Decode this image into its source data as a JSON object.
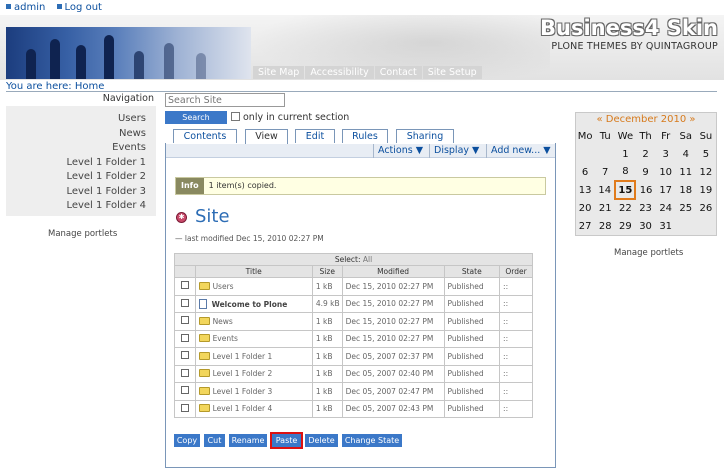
{
  "personal_bar": {
    "items": [
      "admin",
      "Log out"
    ]
  },
  "brand": {
    "name": "Business4 Skin",
    "tagline": "PLONE THEMES BY QUINTAGROUP"
  },
  "site_actions": [
    "Site Map",
    "Accessibility",
    "Contact",
    "Site Setup"
  ],
  "breadcrumb": "You are here: Home",
  "navigation": {
    "title": "Navigation",
    "items": [
      "Users",
      "News",
      "Events",
      "Level 1 Folder 1",
      "Level 1 Folder 2",
      "Level 1 Folder 3",
      "Level 1 Folder 4"
    ],
    "manage": "Manage portlets"
  },
  "search": {
    "placeholder": "Search Site",
    "button": "Search",
    "only_current": "only in current section"
  },
  "tabs": [
    "Contents",
    "View",
    "Edit",
    "Rules",
    "Sharing"
  ],
  "active_tab": "View",
  "menus": [
    "Actions ▼",
    "Display ▼",
    "Add new... ▼"
  ],
  "info": {
    "tag": "Info",
    "message": "1 item(s) copied."
  },
  "page": {
    "title": "Site",
    "modified": "— last modified Dec 15, 2010 02:27 PM"
  },
  "table": {
    "select_label": "Select:",
    "select_all": "All",
    "headers": [
      "",
      "Title",
      "Size",
      "Modified",
      "State",
      "Order"
    ],
    "rows": [
      {
        "title": "Users",
        "size": "1 kB",
        "modified": "Dec 15, 2010 02:27 PM",
        "state": "Published",
        "order": "::",
        "icon": "folder",
        "bold": false
      },
      {
        "title": "Welcome to Plone",
        "size": "4.9 kB",
        "modified": "Dec 15, 2010 02:27 PM",
        "state": "Published",
        "order": "::",
        "icon": "document",
        "bold": true
      },
      {
        "title": "News",
        "size": "1 kB",
        "modified": "Dec 15, 2010 02:27 PM",
        "state": "Published",
        "order": "::",
        "icon": "folder",
        "bold": false
      },
      {
        "title": "Events",
        "size": "1 kB",
        "modified": "Dec 15, 2010 02:27 PM",
        "state": "Published",
        "order": "::",
        "icon": "folder",
        "bold": false
      },
      {
        "title": "Level 1 Folder 1",
        "size": "1 kB",
        "modified": "Dec 05, 2007 02:37 PM",
        "state": "Published",
        "order": "::",
        "icon": "folder",
        "bold": false
      },
      {
        "title": "Level 1 Folder 2",
        "size": "1 kB",
        "modified": "Dec 05, 2007 02:40 PM",
        "state": "Published",
        "order": "::",
        "icon": "folder",
        "bold": false
      },
      {
        "title": "Level 1 Folder 3",
        "size": "1 kB",
        "modified": "Dec 05, 2007 02:47 PM",
        "state": "Published",
        "order": "::",
        "icon": "folder",
        "bold": false
      },
      {
        "title": "Level 1 Folder 4",
        "size": "1 kB",
        "modified": "Dec 05, 2007 02:43 PM",
        "state": "Published",
        "order": "::",
        "icon": "folder",
        "bold": false
      }
    ]
  },
  "buttons": [
    "Copy",
    "Cut",
    "Rename",
    "Paste",
    "Delete",
    "Change State"
  ],
  "highlighted_button": "Paste",
  "calendar": {
    "prev": "«",
    "next": "»",
    "month": "December 2010",
    "days": [
      "Mo",
      "Tu",
      "We",
      "Th",
      "Fr",
      "Sa",
      "Su"
    ],
    "weeks": [
      [
        "",
        "",
        "1",
        "2",
        "3",
        "4",
        "5"
      ],
      [
        "6",
        "7",
        "8",
        "9",
        "10",
        "11",
        "12"
      ],
      [
        "13",
        "14",
        "15",
        "16",
        "17",
        "18",
        "19"
      ],
      [
        "20",
        "21",
        "22",
        "23",
        "24",
        "25",
        "26"
      ],
      [
        "27",
        "28",
        "29",
        "30",
        "31",
        "",
        ""
      ]
    ],
    "today": "15",
    "manage": "Manage portlets"
  },
  "colors": {
    "accent": "#3b78c8",
    "link": "#0b4f9e",
    "calendar_header": "#d77a1c",
    "highlight": "#dd1111"
  }
}
